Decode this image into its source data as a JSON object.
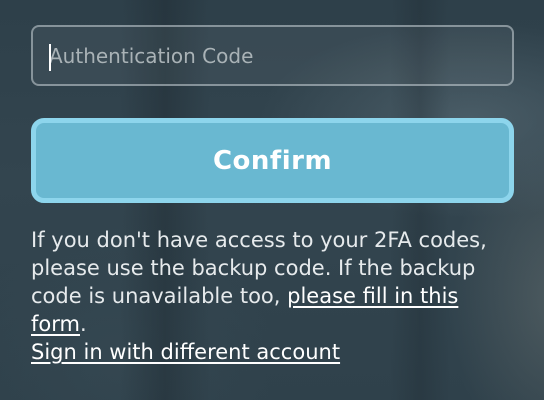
{
  "auth_code": {
    "value": "",
    "placeholder": "Authentication Code"
  },
  "confirm_button": {
    "label": "Confirm"
  },
  "help": {
    "text_before_link": "If you don't have access to your 2FA codes, please use the backup code. If the backup code is unavailable too, ",
    "form_link_label": "please fill in this form",
    "text_after_link": "."
  },
  "switch_account_link": {
    "label": "Sign in with different account"
  },
  "colors": {
    "button_fill": "#69b8d1",
    "button_border": "#8dd5ec",
    "text": "#e6eaec"
  }
}
